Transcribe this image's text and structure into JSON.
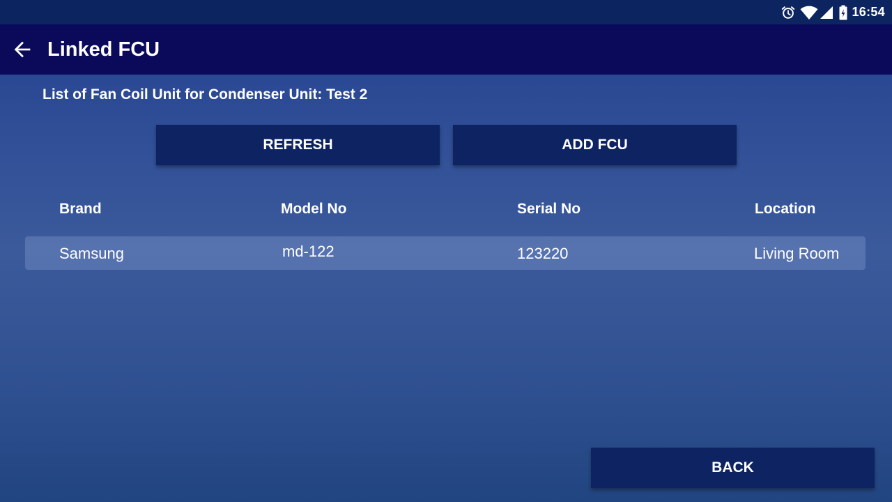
{
  "status_bar": {
    "time": "16:54",
    "icons": [
      "alarm-icon",
      "wifi-icon",
      "signal-icon",
      "battery-charging-icon"
    ]
  },
  "app_bar": {
    "title": "Linked FCU",
    "back_icon": "arrow-back-icon"
  },
  "subtitle": "List of Fan Coil Unit for Condenser Unit: Test 2",
  "buttons": {
    "refresh": "REFRESH",
    "add_fcu": "ADD FCU",
    "back": "BACK"
  },
  "table": {
    "columns": [
      "Brand",
      "Model No",
      "Serial No",
      "Location"
    ],
    "rows": [
      [
        "Samsung",
        "md-122",
        "123220",
        "Living Room"
      ]
    ]
  },
  "colors": {
    "status_bar": "#0c2460",
    "app_bar": "#0b0a5a",
    "button": "#0e2361",
    "background_top": "#213d8e",
    "row_highlight": "#4d68a3"
  }
}
